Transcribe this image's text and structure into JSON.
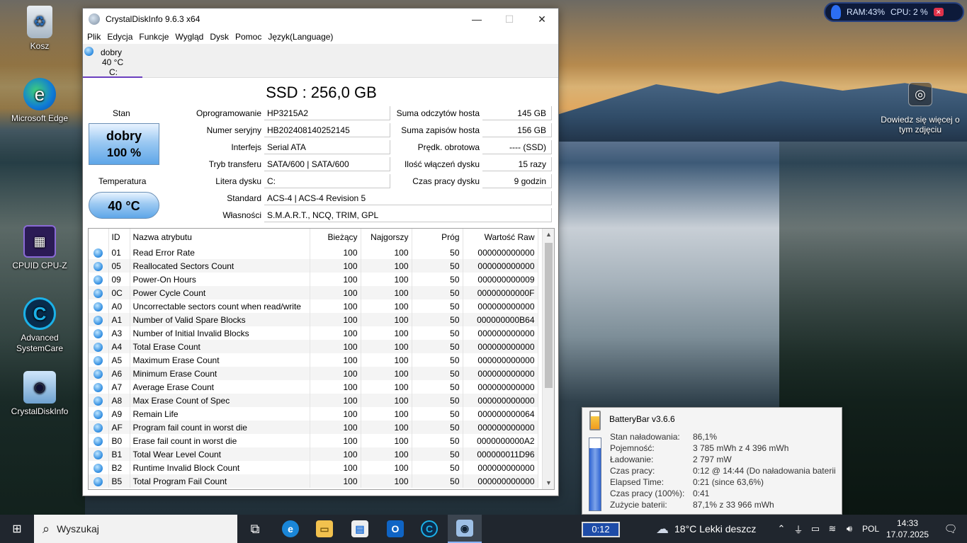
{
  "desktop": {
    "icons": [
      {
        "label": "Kosz",
        "icon": "recycle-bin-icon"
      },
      {
        "label": "Microsoft Edge",
        "icon": "edge-icon"
      },
      {
        "label": "CPUID CPU-Z",
        "icon": "cpuz-icon"
      },
      {
        "label": "Advanced SystemCare",
        "icon": "advanced-systemcare-icon"
      },
      {
        "label": "CrystalDiskInfo",
        "icon": "crystaldiskinfo-icon"
      }
    ],
    "learn_more": "Dowiedz się więcej o tym zdjęciu",
    "sys_widget": {
      "ram": "RAM:43%",
      "cpu": "CPU: 2 %"
    }
  },
  "window": {
    "title": "CrystalDiskInfo 9.6.3 x64",
    "menu": [
      "Plik",
      "Edycja",
      "Funkcje",
      "Wygląd",
      "Dysk",
      "Pomoc",
      "Język(Language)"
    ],
    "disk_tab": {
      "status": "dobry",
      "temp": "40 °C",
      "drive": "C:"
    },
    "disk_title": "SSD : 256,0 GB",
    "status": {
      "label": "Stan",
      "value": "dobry",
      "percent": "100 %"
    },
    "temperature": {
      "label": "Temperatura",
      "value": "40 °C"
    },
    "left_info": [
      {
        "label": "Oprogramowanie",
        "value": "HP3215A2"
      },
      {
        "label": "Numer seryjny",
        "value": "HB202408140252145"
      },
      {
        "label": "Interfejs",
        "value": "Serial ATA"
      },
      {
        "label": "Tryb transferu",
        "value": "SATA/600 | SATA/600"
      },
      {
        "label": "Litera dysku",
        "value": "C:"
      }
    ],
    "right_info": [
      {
        "label": "Suma odczytów hosta",
        "value": "145 GB"
      },
      {
        "label": "Suma zapisów hosta",
        "value": "156 GB"
      },
      {
        "label": "Prędk. obrotowa",
        "value": "---- (SSD)"
      },
      {
        "label": "Ilość włączeń dysku",
        "value": "15 razy"
      },
      {
        "label": "Czas pracy dysku",
        "value": "9 godzin"
      }
    ],
    "standard": {
      "label": "Standard",
      "value": "ACS-4 | ACS-4 Revision 5"
    },
    "features": {
      "label": "Własności",
      "value": "S.M.A.R.T., NCQ, TRIM, GPL"
    },
    "table": {
      "headers": [
        "ID",
        "Nazwa atrybutu",
        "Bieżący",
        "Najgorszy",
        "Próg",
        "Wartość Raw"
      ],
      "rows": [
        [
          "01",
          "Read Error Rate",
          "100",
          "100",
          "50",
          "000000000000"
        ],
        [
          "05",
          "Reallocated Sectors Count",
          "100",
          "100",
          "50",
          "000000000000"
        ],
        [
          "09",
          "Power-On Hours",
          "100",
          "100",
          "50",
          "000000000009"
        ],
        [
          "0C",
          "Power Cycle Count",
          "100",
          "100",
          "50",
          "00000000000F"
        ],
        [
          "A0",
          "Uncorrectable sectors count when read/write",
          "100",
          "100",
          "50",
          "000000000000"
        ],
        [
          "A1",
          "Number of Valid Spare Blocks",
          "100",
          "100",
          "50",
          "000000000B64"
        ],
        [
          "A3",
          "Number of Initial Invalid Blocks",
          "100",
          "100",
          "50",
          "000000000000"
        ],
        [
          "A4",
          "Total Erase Count",
          "100",
          "100",
          "50",
          "000000000000"
        ],
        [
          "A5",
          "Maximum Erase Count",
          "100",
          "100",
          "50",
          "000000000000"
        ],
        [
          "A6",
          "Minimum Erase Count",
          "100",
          "100",
          "50",
          "000000000000"
        ],
        [
          "A7",
          "Average Erase Count",
          "100",
          "100",
          "50",
          "000000000000"
        ],
        [
          "A8",
          "Max Erase Count of Spec",
          "100",
          "100",
          "50",
          "000000000000"
        ],
        [
          "A9",
          "Remain Life",
          "100",
          "100",
          "50",
          "000000000064"
        ],
        [
          "AF",
          "Program fail count in worst die",
          "100",
          "100",
          "50",
          "000000000000"
        ],
        [
          "B0",
          "Erase fail count in worst die",
          "100",
          "100",
          "50",
          "0000000000A2"
        ],
        [
          "B1",
          "Total Wear Level Count",
          "100",
          "100",
          "50",
          "000000011D96"
        ],
        [
          "B2",
          "Runtime Invalid Block Count",
          "100",
          "100",
          "50",
          "000000000000"
        ],
        [
          "B5",
          "Total Program Fail Count",
          "100",
          "100",
          "50",
          "000000000000"
        ]
      ]
    }
  },
  "battery_popup": {
    "title": "BatteryBar v3.6.6",
    "charge_fraction": 0.861,
    "rows": [
      {
        "k": "Stan naładowania:",
        "v": "86,1%"
      },
      {
        "k": "Pojemność:",
        "v": "3 785 mWh z 4 396 mWh"
      },
      {
        "k": "Ładowanie:",
        "v": "2 797 mW"
      },
      {
        "k": "Czas pracy:",
        "v": "0:12 @ 14:44 (Do naładowania baterii"
      },
      {
        "k": "Elapsed Time:",
        "v": "0:21 (since 63,6%)"
      },
      {
        "k": "Czas pracy (100%):",
        "v": "0:41"
      },
      {
        "k": "Zużycie baterii:",
        "v": "87,1% z 33 966 mWh"
      }
    ]
  },
  "taskbar": {
    "search_placeholder": "Wyszukaj",
    "battery_pill": "0:12",
    "weather": "18°C  Lekki deszcz",
    "language": "POL",
    "time": "14:33",
    "date": "17.07.2025"
  }
}
